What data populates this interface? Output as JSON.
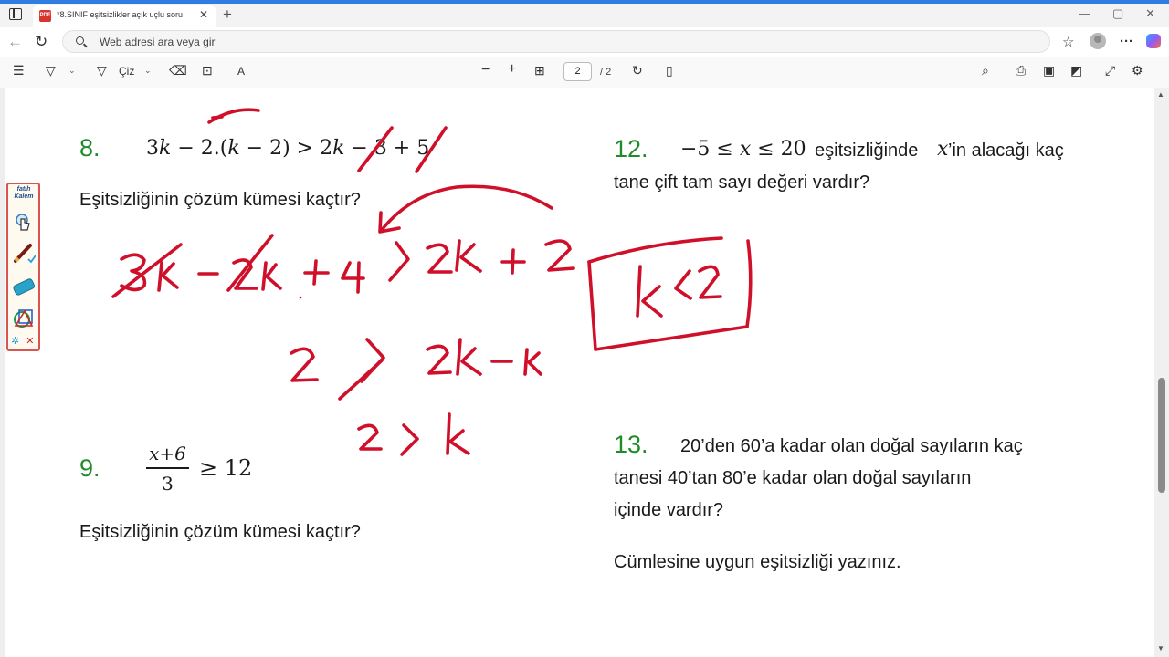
{
  "browser": {
    "tab_title": "*8.SINIF eşitsizlikler açık uçlu soru",
    "tab_close": "✕",
    "new_tab": "+",
    "pdf_badge": "PDF",
    "window_controls": {
      "minimize": "—",
      "restore": "▢",
      "close": "✕"
    },
    "nav": {
      "back": "←",
      "refresh": "↻"
    },
    "address_placeholder": "Web adresi ara veya gir",
    "icons": [
      "sidebar-toggle-icon",
      "search-icon",
      "favorites-star-icon",
      "profile-avatar-icon",
      "more-menu-icon",
      "copilot-icon"
    ]
  },
  "pdf_toolbar": {
    "draw_label": "Çiz",
    "zoom_out": "−",
    "zoom_in": "+",
    "current_page": "2",
    "total_pages": "/ 2",
    "icons": [
      "contents-icon",
      "highlight-icon",
      "draw-icon",
      "eraser-icon",
      "text-icon",
      "read-aloud-icon",
      "fit-page-icon",
      "rotate-icon",
      "two-page-icon",
      "find-icon",
      "print-icon",
      "save-icon",
      "save-as-icon",
      "fullscreen-icon",
      "settings-icon"
    ]
  },
  "kalem": {
    "logo_top": "fatih",
    "logo_bottom": "Kalem",
    "close": "✕",
    "tools": [
      "pointer-hand-icon",
      "pen-icon",
      "eraser-icon",
      "shapes-icon",
      "settings-gear-icon"
    ]
  },
  "questions": {
    "q8": {
      "number": "8.",
      "expression": "3𝑘 − 2.(𝑘 − 2) > 2𝑘 − 3 + 5",
      "prompt": "Eşitsizliğinin çözüm kümesi kaçtır?"
    },
    "q9": {
      "number": "9.",
      "numerator": "x+6",
      "denominator": "3",
      "rhs": "≥ 12",
      "prompt": "Eşitsizliğinin çözüm kümesi kaçtır?"
    },
    "q12": {
      "number": "12.",
      "line1_math": "−5 ≤ 𝑥 ≤ 20",
      "line1_text": "eşitsizliğinde",
      "line1_var": "𝑥",
      "line1_rest": "’in alacağı kaç",
      "line2": "tane çift tam sayı değeri vardır?"
    },
    "q13": {
      "number": "13.",
      "line1": "20’den 60’a kadar olan doğal sayıların kaç",
      "line2": "tanesi 40’tan 80’e kadar olan doğal sayıların",
      "line3": "içinde vardır?",
      "line4": "Cümlesine uygun eşitsizliği yazınız."
    }
  },
  "handwriting": {
    "step1": "3k − 2k + 4 > 2k + 2",
    "step2": "2 > 2k − k",
    "step3": "2 > k",
    "boxed_answer": "k < 2"
  },
  "colors": {
    "question_number": "#1f8b2a",
    "ink": "#d0102a",
    "accent": "#2f7de1"
  }
}
